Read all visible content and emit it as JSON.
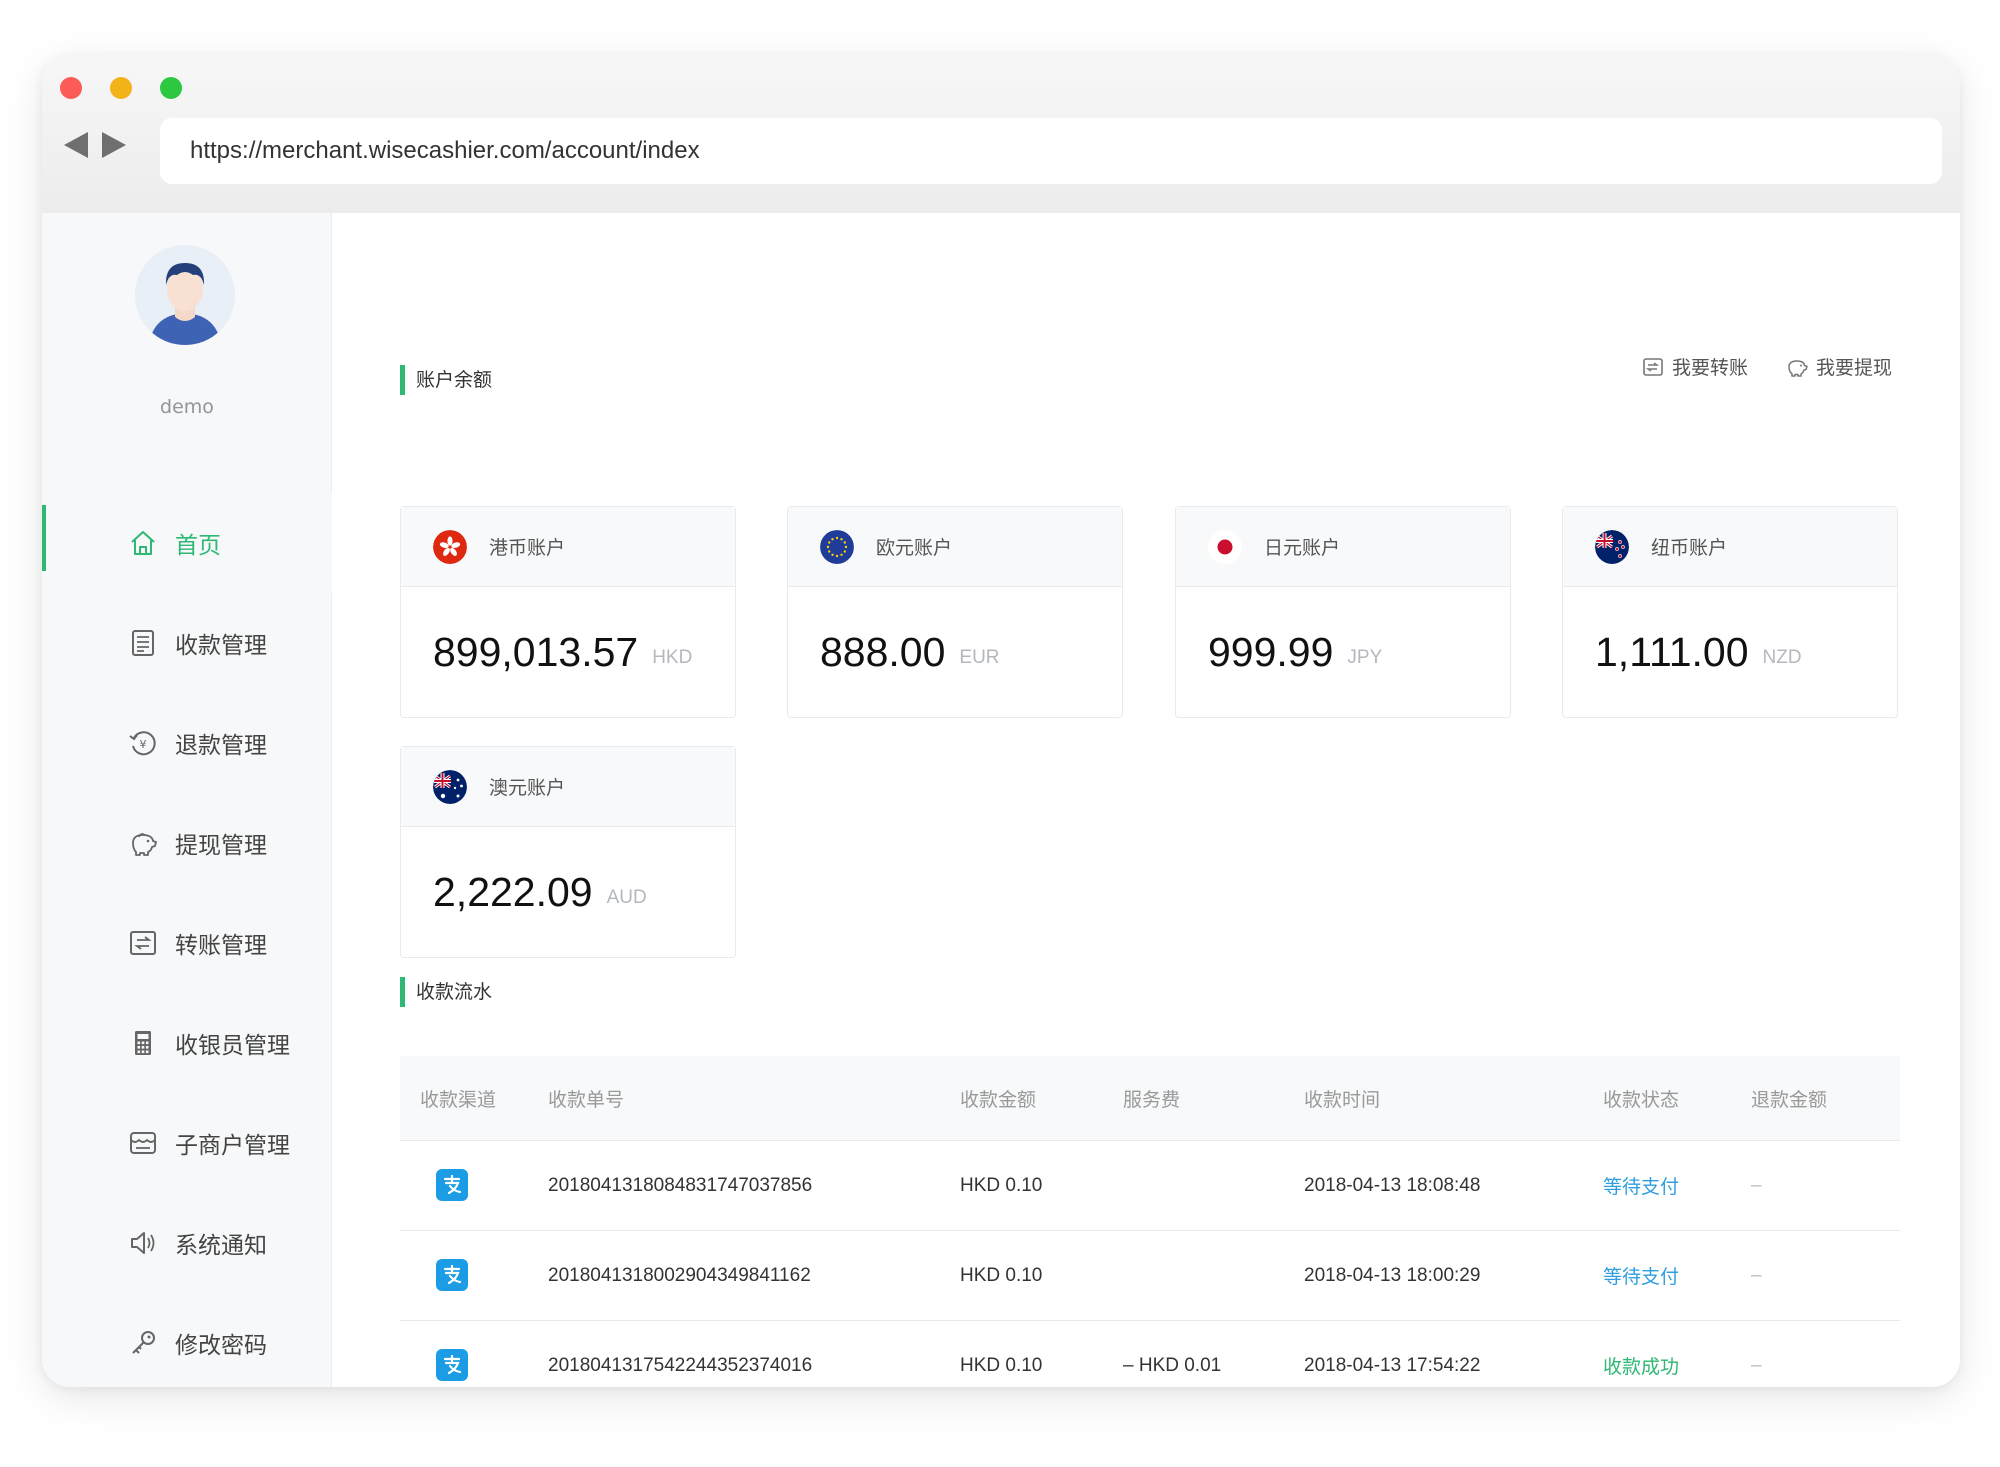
{
  "browser": {
    "url": "https://merchant.wisecashier.com/account/index"
  },
  "user": {
    "name": "demo"
  },
  "menu": [
    {
      "label": "首页",
      "icon": "home-icon",
      "active": true
    },
    {
      "label": "收款管理",
      "icon": "receipt-icon"
    },
    {
      "label": "退款管理",
      "icon": "refund-icon"
    },
    {
      "label": "提现管理",
      "icon": "piggy-bank-icon"
    },
    {
      "label": "转账管理",
      "icon": "transfer-icon"
    },
    {
      "label": "收银员管理",
      "icon": "calculator-icon"
    },
    {
      "label": "子商户管理",
      "icon": "store-icon"
    },
    {
      "label": "系统通知",
      "icon": "speaker-icon"
    },
    {
      "label": "修改密码",
      "icon": "key-icon"
    }
  ],
  "balance": {
    "title": "账户余额",
    "actions": {
      "transfer": "我要转账",
      "withdraw": "我要提现"
    },
    "accounts": [
      {
        "name": "港币账户",
        "amount": "899,013.57",
        "currency": "HKD",
        "flag": "hong-kong-flag-icon"
      },
      {
        "name": "欧元账户",
        "amount": "888.00",
        "currency": "EUR",
        "flag": "eu-flag-icon"
      },
      {
        "name": "日元账户",
        "amount": "999.99",
        "currency": "JPY",
        "flag": "japan-flag-icon"
      },
      {
        "name": "纽币账户",
        "amount": "1,111.00",
        "currency": "NZD",
        "flag": "new-zealand-flag-icon"
      },
      {
        "name": "澳元账户",
        "amount": "2,222.09",
        "currency": "AUD",
        "flag": "australia-flag-icon"
      }
    ]
  },
  "transactions": {
    "title": "收款流水",
    "columns": [
      "收款渠道",
      "收款单号",
      "收款金额",
      "服务费",
      "收款时间",
      "收款状态",
      "退款金额"
    ],
    "rows": [
      {
        "channel": "alipay-icon",
        "order": "2018041318084831747037856",
        "amount": "HKD 0.10",
        "fee": "",
        "time": "2018-04-13 18:08:48",
        "status": "等待支付",
        "refund": "–"
      },
      {
        "channel": "alipay-icon",
        "order": "2018041318002904349841162",
        "amount": "HKD 0.10",
        "fee": "",
        "time": "2018-04-13 18:00:29",
        "status": "等待支付",
        "refund": "–"
      },
      {
        "channel": "alipay-icon",
        "order": "2018041317542244352374016",
        "amount": "HKD 0.10",
        "fee": "– HKD 0.01",
        "time": "2018-04-13 17:54:22",
        "status": "收款成功",
        "refund": "–"
      }
    ]
  },
  "colors": {
    "accent": "#2eb873",
    "pending": "#2f9ee0",
    "alipay": "#1b9ce4"
  }
}
